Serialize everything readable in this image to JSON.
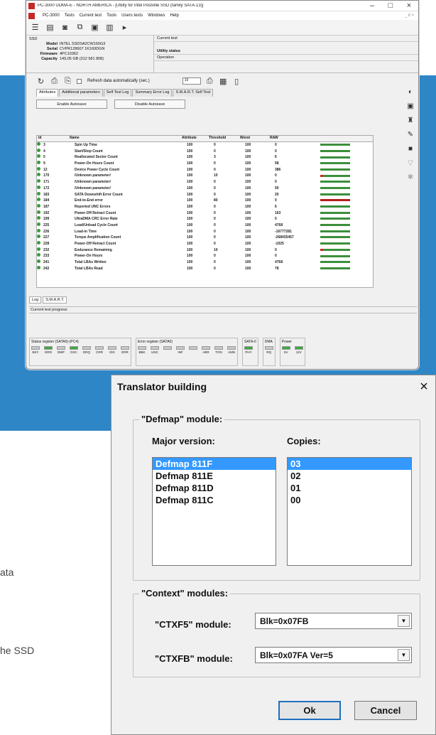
{
  "background_text": {
    "line1": "ata",
    "line2": "he SSD"
  },
  "pc3000": {
    "title": "PC-3000 UDMA-E - NORTH AMERICA - [Utility for Intel Postville SSD (family SATA-13)]",
    "window_controls": [
      "–",
      "□",
      "×"
    ],
    "menu": [
      "PC-3000",
      "Tests",
      "Current test",
      "Tools",
      "Users tests",
      "Windows",
      "Help"
    ],
    "menu_right": "_ ∂ ×",
    "info_header": "SSD",
    "drive": {
      "model_label": "Model",
      "model": "INTEL SSDSA2CW160G3",
      "serial_label": "Serial",
      "serial": "CVPR128607 1K160DGN",
      "firmware_label": "Firmware",
      "firmware": "4PC10362",
      "capacity_label": "Capacity",
      "capacity": "149,05 GB (312 581 808)"
    },
    "current_test_label": "Current test",
    "utility_status_label": "Utility status",
    "operation_label": "Operation",
    "refresh_label": "Refresh data automatically (sec.)",
    "refresh_value": "10",
    "tabs": [
      "Attributes",
      "Additional parameters",
      "Self Test Log",
      "Summary Error Log",
      "S.M.A.R.T. Self Test"
    ],
    "enable_autosave": "Enable Autosave",
    "disable_autosave": "Disable Autosave",
    "columns": [
      "Id",
      "Name",
      "Attribute",
      "Threshold",
      "Worst",
      "RAW"
    ],
    "rows": [
      {
        "id": "3",
        "name": "Spin Up Time",
        "attr": "100",
        "thr": "0",
        "worst": "100",
        "raw": "0",
        "flag": ""
      },
      {
        "id": "4",
        "name": "Start/Stop Count",
        "attr": "100",
        "thr": "0",
        "worst": "100",
        "raw": "0",
        "flag": ""
      },
      {
        "id": "5",
        "name": "Reallocated Sector Count",
        "attr": "100",
        "thr": "3",
        "worst": "100",
        "raw": "6",
        "flag": ""
      },
      {
        "id": "9",
        "name": "Power-On Hours Count",
        "attr": "100",
        "thr": "0",
        "worst": "100",
        "raw": "58",
        "flag": ""
      },
      {
        "id": "12",
        "name": "Device Power Cycle Count",
        "attr": "100",
        "thr": "0",
        "worst": "100",
        "raw": "386",
        "flag": ""
      },
      {
        "id": "170",
        "name": "/Unknown parameter/",
        "attr": "100",
        "thr": "10",
        "worst": "100",
        "raw": "0",
        "flag": "warn"
      },
      {
        "id": "171",
        "name": "/Unknown parameter/",
        "attr": "100",
        "thr": "0",
        "worst": "100",
        "raw": "0",
        "flag": ""
      },
      {
        "id": "172",
        "name": "/Unknown parameter/",
        "attr": "100",
        "thr": "0",
        "worst": "100",
        "raw": "50",
        "flag": ""
      },
      {
        "id": "183",
        "name": "SATA Downshift Error Count",
        "attr": "100",
        "thr": "0",
        "worst": "100",
        "raw": "20",
        "flag": ""
      },
      {
        "id": "184",
        "name": "End-to-End error",
        "attr": "100",
        "thr": "80",
        "worst": "100",
        "raw": "0",
        "flag": "red"
      },
      {
        "id": "187",
        "name": "Reported UNC Errors",
        "attr": "100",
        "thr": "0",
        "worst": "100",
        "raw": "6",
        "flag": ""
      },
      {
        "id": "192",
        "name": "Power-Off Retract Count",
        "attr": "100",
        "thr": "0",
        "worst": "100",
        "raw": "163",
        "flag": ""
      },
      {
        "id": "199",
        "name": "UltraDMA CRC Error Rate",
        "attr": "100",
        "thr": "0",
        "worst": "100",
        "raw": "0",
        "flag": ""
      },
      {
        "id": "225",
        "name": "Load/Unload Cycle Count",
        "attr": "100",
        "thr": "0",
        "worst": "100",
        "raw": "4768",
        "flag": ""
      },
      {
        "id": "226",
        "name": "Load-in Time",
        "attr": "100",
        "thr": "0",
        "worst": "100",
        "raw": "-16777281",
        "flag": ""
      },
      {
        "id": "227",
        "name": "Torque Amplification Count",
        "attr": "100",
        "thr": "0",
        "worst": "100",
        "raw": "-268435457",
        "flag": ""
      },
      {
        "id": "228",
        "name": "Power-Off Retract Count",
        "attr": "100",
        "thr": "0",
        "worst": "100",
        "raw": "-1025",
        "flag": ""
      },
      {
        "id": "232",
        "name": "Endurance Remaining",
        "attr": "100",
        "thr": "10",
        "worst": "100",
        "raw": "0",
        "flag": "warn"
      },
      {
        "id": "233",
        "name": "Power-On Hours",
        "attr": "100",
        "thr": "0",
        "worst": "100",
        "raw": "0",
        "flag": ""
      },
      {
        "id": "241",
        "name": "Total LBAs Written",
        "attr": "100",
        "thr": "0",
        "worst": "100",
        "raw": "4768",
        "flag": ""
      },
      {
        "id": "242",
        "name": "Total LBAs Read",
        "attr": "100",
        "thr": "0",
        "worst": "100",
        "raw": "78",
        "flag": ""
      }
    ],
    "bottom_tabs": [
      "Log",
      "S.M.A.R.T."
    ],
    "progress_label": "Current test progress",
    "status_register_label": "Status register (SATA0)-(PC4)",
    "status_leds": [
      {
        "name": "BSY",
        "on": false
      },
      {
        "name": "DRD",
        "on": true
      },
      {
        "name": "DWF",
        "on": false
      },
      {
        "name": "DSC",
        "on": true
      },
      {
        "name": "DRQ",
        "on": false
      },
      {
        "name": "CRR",
        "on": false
      },
      {
        "name": "IDX",
        "on": false
      },
      {
        "name": "ERR",
        "on": false
      }
    ],
    "error_register_label": "Error register (SATA0)",
    "error_leds": [
      {
        "name": "BBK",
        "on": false
      },
      {
        "name": "UNC",
        "on": false
      },
      {
        "name": "",
        "on": false
      },
      {
        "name": "INF",
        "on": false
      },
      {
        "name": "",
        "on": false
      },
      {
        "name": "ABR",
        "on": false
      },
      {
        "name": "TON",
        "on": false
      },
      {
        "name": "AMN",
        "on": false
      }
    ],
    "sata_label": "SATA-II",
    "sata_leds": [
      {
        "name": "PHY",
        "on": true
      }
    ],
    "dma_label": "DMA",
    "dma_leds": [
      {
        "name": "RQ",
        "on": false
      }
    ],
    "power_label": "Power",
    "power_leds": [
      {
        "name": "5V",
        "on": true
      },
      {
        "name": "12V",
        "on": true
      }
    ]
  },
  "dialog": {
    "title": "Translator building",
    "close": "×",
    "defmap_legend": "\"Defmap\" module:",
    "major_version_label": "Major version:",
    "copies_label": "Copies:",
    "versions": [
      "Defmap 811F",
      "Defmap 811E",
      "Defmap 811D",
      "Defmap 811C"
    ],
    "selected_version": 0,
    "copies": [
      "03",
      "02",
      "01",
      "00"
    ],
    "selected_copy": 0,
    "context_legend": "\"Context\" modules:",
    "ctxf5_label": "\"CTXF5\" module:",
    "ctxf5_value": "Blk=0x07FB",
    "ctxfb_label": "\"CTXFB\" module:",
    "ctxfb_value": "Blk=0x07FA Ver=5",
    "ok": "Ok",
    "cancel": "Cancel"
  },
  "colors": {
    "accent_blue": "#2e86c7",
    "selection": "#3399ff",
    "led_on": "#3fa83f",
    "alert": "#c62828"
  }
}
